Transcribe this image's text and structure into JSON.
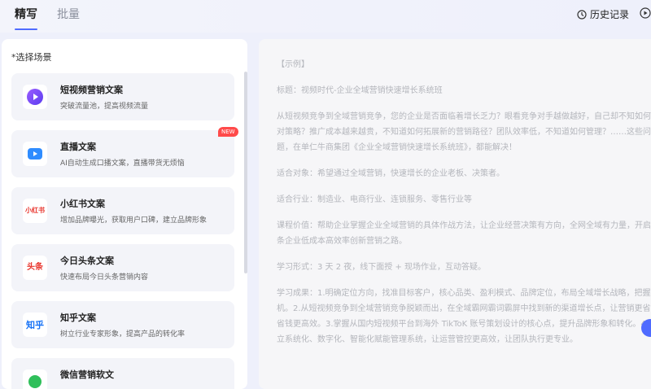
{
  "header": {
    "tab_write": "精写",
    "tab_batch": "批量",
    "history": "历史记录"
  },
  "left": {
    "scene_label": "*选择场景",
    "new_badge": "NEW",
    "cards": [
      {
        "title": "短视频营销文案",
        "desc": "突破流量池，提高视频流量",
        "icon": "play-icon"
      },
      {
        "title": "直播文案",
        "desc": "AI自动生成口播文案，直播带货无烦恼",
        "icon": "live-camera-icon"
      },
      {
        "title": "小红书文案",
        "desc": "增加品牌曝光，获取用户口碑，建立品牌形象",
        "icon_text": "小红书"
      },
      {
        "title": "今日头条文案",
        "desc": "快速布局今日头条营销内容",
        "icon_text": "头条"
      },
      {
        "title": "知乎文案",
        "desc": "树立行业专家形象，提高产品的转化率",
        "icon_text": "知乎"
      },
      {
        "title": "微信营销软文",
        "desc": "",
        "icon": "wechat-icon"
      }
    ]
  },
  "example": {
    "heading": "【示例】",
    "title_line": "标题：视频时代-企业全域营销快速增长系统班",
    "intro": "从短视频竞争到全域营销竞争，您的企业是否面临着增长乏力？眼看竞争对手越做越好，自己却不知如何应对策略？推广成本越来越贵，不知道如何拓展新的营销路径？团队效率低，不知道如何管理？……这些问题，在单仁牛商集团《企业全域营销快速增长系统班》，都能解决！",
    "audience": "适合对象：希望通过全域营销，快速增长的企业老板、决策者。",
    "industry": "适合行业：制造业、电商行业、连锁服务、零售行业等",
    "value": "课程价值：帮助企业掌握企业全域营销的具体作战方法，让企业经营决策有方向，全网全域有力量，开启一条企业低成本高效率创新营销之路。",
    "format": "学习形式：3 天 2 夜，线下面授 + 现场作业，互动答疑。",
    "results": "学习成果：1.明确定位方向，找准目标客户，核心品类、盈利模式、品牌定位，布局全域增长战略，把握商机。2.从短视频竞争到全域营销竞争脱颖而出，在全域霸网霸词霸屏中找到新的渠道增长点，让营销更省钱省钱更高效。3.掌握从国内短视频平台到海外 TikToK 账号策划设计的核心点，提升品牌形象和转化。4.建立系统化、数字化、智能化赋能管理系统，让运营管控更高效，让团队执行更专业。"
  },
  "colors": {
    "accent": "#4f6bff",
    "new_badge": "#ff4a4a",
    "red_brand": "#e8322a",
    "zhihu_blue": "#1772f6"
  }
}
